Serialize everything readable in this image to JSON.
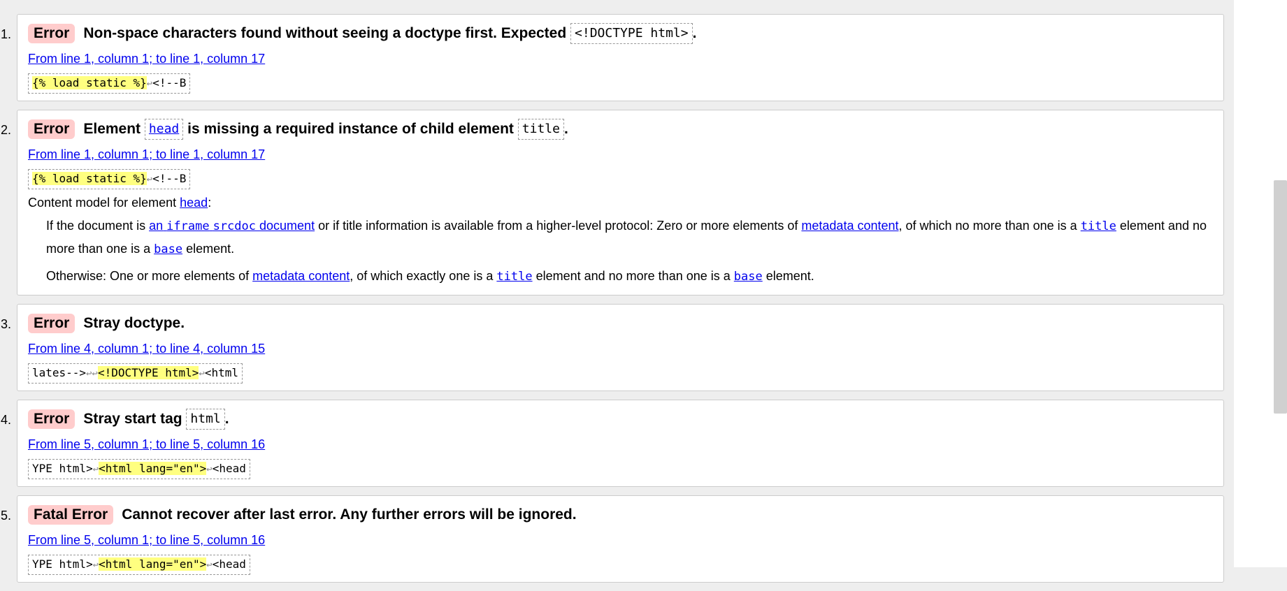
{
  "messages": [
    {
      "num": "1.",
      "badge": "Error",
      "head": {
        "p1": "Non-space characters found without seeing a doctype first. Expected",
        "code1": "<!DOCTYPE html>",
        "p2": "."
      },
      "location": "From line 1, column 1; to line 1, column 17",
      "extract": {
        "hl": "{% load static %}",
        "lf": "↩",
        "post": "<!--B"
      }
    },
    {
      "num": "2.",
      "badge": "Error",
      "head": {
        "p1": "Element",
        "code1": "head",
        "p2": "is missing a required instance of child element",
        "code2": "title",
        "p3": "."
      },
      "location": "From line 1, column 1; to line 1, column 17",
      "extract": {
        "hl": "{% load static %}",
        "lf": "↩",
        "post": "<!--B"
      },
      "content_model": {
        "label": "Content model for element",
        "label_link": "head",
        "label_colon": ":",
        "para1": {
          "t1": "If the document is",
          "link1a": "an",
          "code1": "iframe",
          "code2": "srcdoc",
          "link1b": "document",
          "t2": "or if title information is available from a higher-level protocol: Zero or more elements of",
          "link2": "metadata content",
          "t3": ", of which no more than one is a",
          "code3": "title",
          "t4": "element and no more than one is a",
          "code4": "base",
          "t5": "element."
        },
        "para2": {
          "t1": "Otherwise: One or more elements of",
          "link1": "metadata content",
          "t2": ", of which exactly one is a",
          "code1": "title",
          "t3": "element and no more than one is a",
          "code2": "base",
          "t4": "element."
        }
      }
    },
    {
      "num": "3.",
      "badge": "Error",
      "head": {
        "p1": "Stray doctype."
      },
      "location": "From line 4, column 1; to line 4, column 15",
      "extract": {
        "pre": "lates-->",
        "lf1": "↩",
        "lf2": "↩",
        "hl": "<!DOCTYPE html>",
        "lf3": "↩",
        "post": "<html"
      }
    },
    {
      "num": "4.",
      "badge": "Error",
      "head": {
        "p1": "Stray start tag",
        "code1": "html",
        "p2": "."
      },
      "location": "From line 5, column 1; to line 5, column 16",
      "extract": {
        "pre": "YPE html>",
        "lf1": "↩",
        "hl": "<html lang=\"en\">",
        "lf2": "↩",
        "post": "<head"
      }
    },
    {
      "num": "5.",
      "badge": "Fatal Error",
      "head": {
        "p1": "Cannot recover after last error. Any further errors will be ignored."
      },
      "location": "From line 5, column 1; to line 5, column 16",
      "extract": {
        "pre": "YPE html>",
        "lf1": "↩",
        "hl": "<html lang=\"en\">",
        "lf2": "↩",
        "post": "<head"
      }
    }
  ],
  "colors": {
    "badge_bg": "#ffcccc",
    "highlight": "#ffff80",
    "link": "#0000ee",
    "page_bg": "#eeeeee"
  }
}
